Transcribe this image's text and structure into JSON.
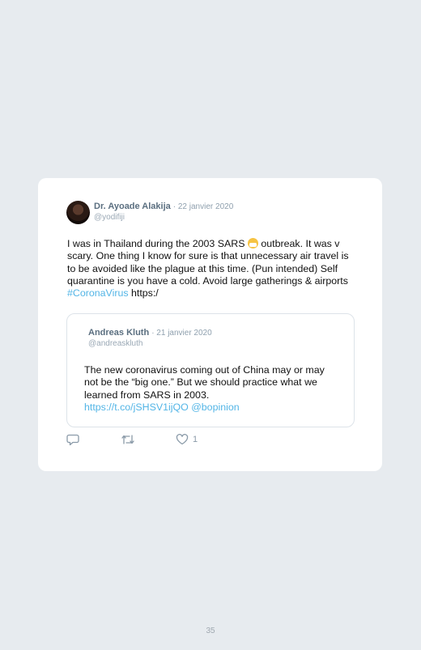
{
  "tweet": {
    "author": "Dr. Ayoade Alakija",
    "date": "· 22 janvier 2020",
    "handle": "@yodifiji",
    "text_part1": "I was in Thailand during the 2003 SARS ",
    "text_part2": " outbreak. It was v scary. One thing I know for sure is that unnecessary air travel is to be avoided like the plague at this time. (Pun intended) Self quarantine is you have a cold. Avoid large gatherings & airports ",
    "hashtag": "#CoronaVirus",
    "text_part3": " https:/",
    "emoji": "face-with-medical-mask-icon"
  },
  "quoted": {
    "author": "Andreas Kluth",
    "date": "· 21 janvier 2020",
    "handle": "@andreaskluth",
    "text": "The new coronavirus coming out of China may or may not be the “big one.” But we should practice what we learned from SARS in 2003.",
    "link": "https://t.co/jSHSV1ijQO @bopinion"
  },
  "actions": {
    "reply_icon": "reply-icon",
    "retweet_icon": "retweet-icon",
    "like_icon": "heart-icon",
    "like_count": "1"
  },
  "page": {
    "number": "35"
  },
  "colors": {
    "background": "#e7ebef",
    "card": "#ffffff",
    "link": "#53b5e6",
    "muted": "#8a9aa8"
  }
}
